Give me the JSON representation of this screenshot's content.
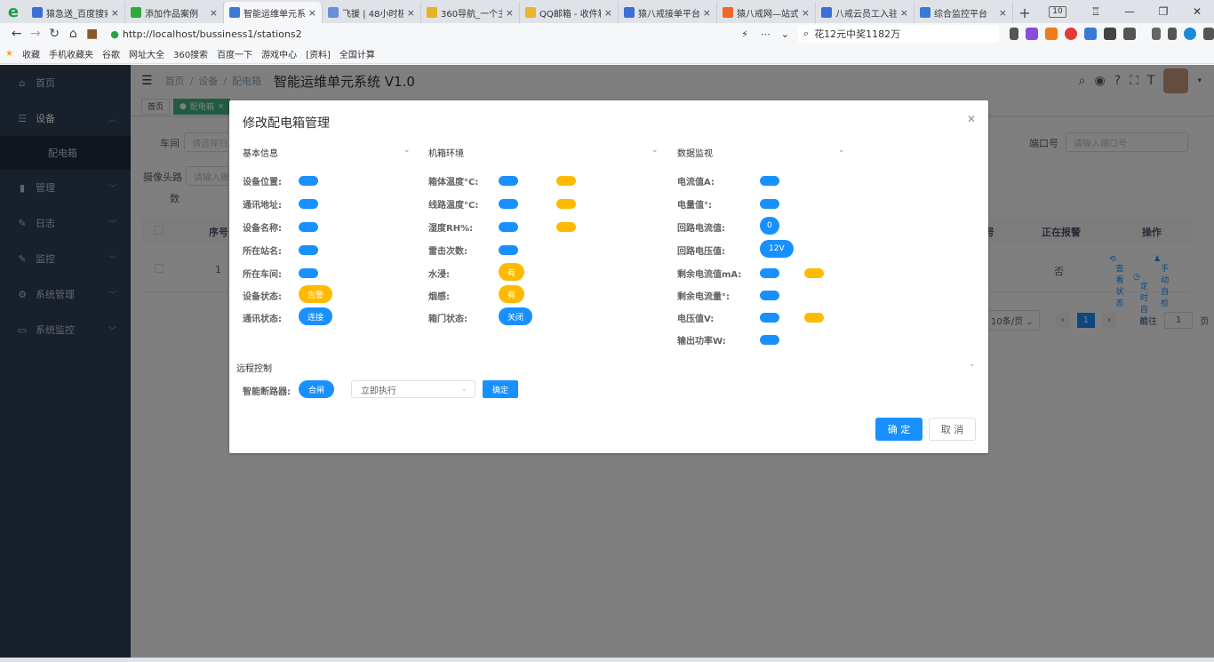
{
  "browser": {
    "tabs": [
      {
        "title": "猿急送_百度搜索",
        "color": "#3a6fd8"
      },
      {
        "title": "添加作品案例",
        "color": "#2eaa3c"
      },
      {
        "title": "智能运维单元系统",
        "color": "#3a7bd5"
      },
      {
        "title": "飞援 | 48小时极速",
        "color": "#6b8fd6"
      },
      {
        "title": "360导航_一个主页",
        "color": "#e5b31b"
      },
      {
        "title": "QQ邮箱 - 收件箱",
        "color": "#f0b429"
      },
      {
        "title": "猿八戒接单平台管",
        "color": "#3a6fd8"
      },
      {
        "title": "猿八戒网—站式",
        "color": "#f26522"
      },
      {
        "title": "八戒云员工入驻",
        "color": "#3a6fd8"
      },
      {
        "title": "综合监控平台",
        "color": "#3a7bd5"
      }
    ],
    "active_tab": 2,
    "tab_close": "×",
    "new_tab": "+",
    "tab_count": "10",
    "url": "http://localhost/bussiness1/stations2",
    "search_text": "花12元中奖1182万",
    "bookmarks": [
      "收藏",
      "手机收藏夹",
      "谷歌",
      "网址大全",
      "360搜索",
      "百度一下",
      "游戏中心",
      "[资料]",
      "全国计算"
    ]
  },
  "sidebar": {
    "items": [
      {
        "label": "首页",
        "icon": "dashboard-icon",
        "glyph": "⌂"
      },
      {
        "label": "设备",
        "icon": "list-icon",
        "glyph": "☰"
      },
      {
        "label": "管理",
        "icon": "chart-icon",
        "glyph": "▮"
      },
      {
        "label": "日志",
        "icon": "edit-icon",
        "glyph": "✎"
      },
      {
        "label": "监控",
        "icon": "edit-icon",
        "glyph": "✎"
      },
      {
        "label": "系统管理",
        "icon": "gear-icon",
        "glyph": "⚙"
      },
      {
        "label": "系统监控",
        "icon": "monitor-icon",
        "glyph": "▭"
      }
    ],
    "sub_item": "配电箱"
  },
  "navbar": {
    "crumbs": [
      "首页",
      "设备",
      "配电箱"
    ],
    "separator": "/",
    "title": "智能运维单元系统 V1.0"
  },
  "tagsview": {
    "tags": [
      "首页",
      "配电箱"
    ]
  },
  "filters": {
    "workshop_label": "车间",
    "workshop_placeholder": "请选择归",
    "port_label": "端口号",
    "port_placeholder": "请输入端口号",
    "camera_label": "摄像头路",
    "camera_label2": "数",
    "camera_placeholder": "请输入摄"
  },
  "table": {
    "headers": {
      "index": "序号",
      "col3": "号",
      "alarm": "正在报警",
      "ops": "操作"
    },
    "row": {
      "index": "1",
      "alarm": "否",
      "op_view": "查看状态",
      "op_manual": "手动自检",
      "op_timed": "定时自检"
    }
  },
  "pagination": {
    "page_size": "10条/页",
    "current": "1",
    "goto_label": "前往",
    "goto_value": "1",
    "page_unit": "页"
  },
  "dialog": {
    "title": "修改配电箱管理",
    "sections": {
      "basic": "基本信息",
      "env": "机箱环境",
      "monitor": "数据监视",
      "remote": "远程控制"
    },
    "basic": {
      "labels": [
        "设备位置:",
        "通讯地址:",
        "设备名称:",
        "所在站名:",
        "所在车间:",
        "设备状态:",
        "通讯状态:"
      ],
      "status_value": "告警",
      "comm_value": "连接"
    },
    "env": {
      "labels": [
        "箱体温度°C:",
        "线路温度°C:",
        "湿度RH%:",
        "雷击次数:",
        "水浸:",
        "烟感:",
        "箱门状态:"
      ],
      "water_value": "有",
      "smoke_value": "有",
      "door_value": "关闭"
    },
    "monitor": {
      "labels": [
        "电流值A:",
        "电量值°:",
        "回路电流值:",
        "回路电压值:",
        "剩余电流值mA:",
        "剩余电流量°:",
        "电压值V:",
        "输出功率W:"
      ],
      "loop_current": "0",
      "loop_voltage": "12V"
    },
    "remote": {
      "breaker_label": "智能断路器:",
      "breaker_value": "合闸",
      "exec_option": "立即执行",
      "confirm_small": "确定"
    },
    "confirm": "确 定",
    "cancel": "取 消"
  },
  "colors": {
    "primary": "#1890ff",
    "warning": "#ffba00",
    "sidebar": "#304156",
    "active_tag": "#42b983"
  }
}
